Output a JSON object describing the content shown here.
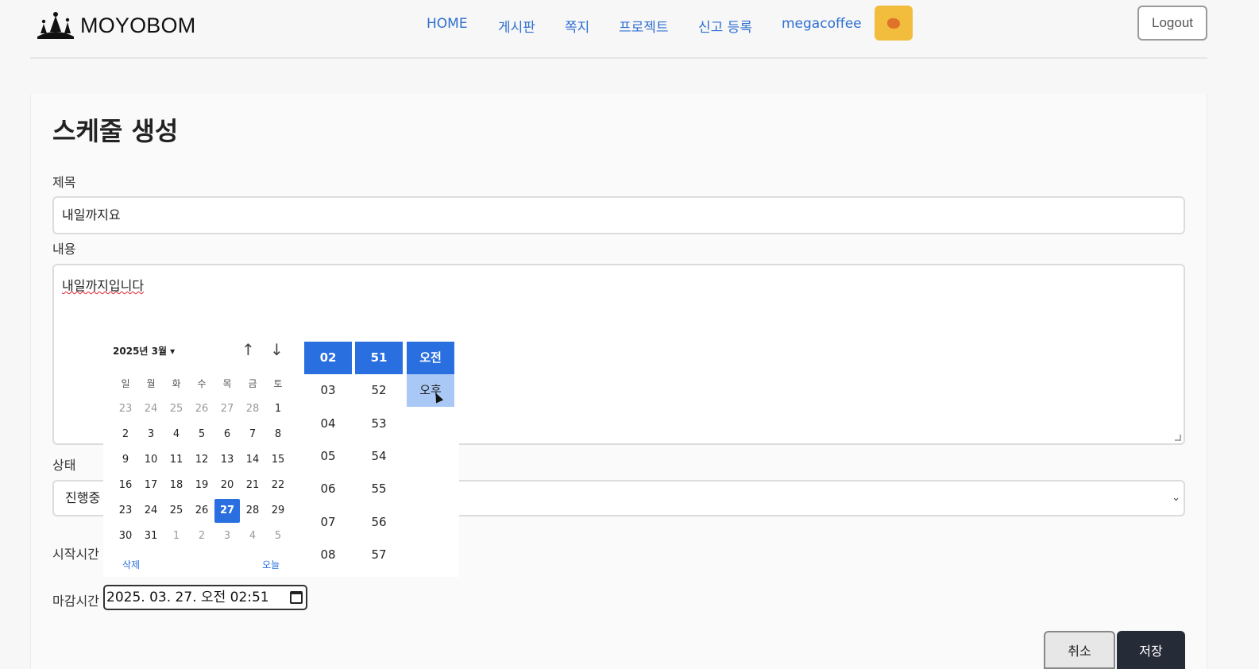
{
  "header": {
    "logo_text": "MOYOBOM",
    "nav": [
      "HOME",
      "게시판",
      "쪽지",
      "프로젝트",
      "신고 등록",
      "megacoffee"
    ],
    "logout_label": "Logout"
  },
  "form": {
    "page_title": "스케줄 생성",
    "title_label": "제목",
    "title_value": "내일까지요",
    "content_label": "내용",
    "content_value": "내일까지입니다",
    "status_label": "상태",
    "status_value": "진행중",
    "start_label": "시작시간",
    "due_label": "마감시간",
    "due_value": "2025. 03. 27. 오전 02:51"
  },
  "datepicker": {
    "month_label": "2025년 3월 ▾",
    "up_arrow": "↑",
    "down_arrow": "↓",
    "weekdays": [
      "일",
      "월",
      "화",
      "수",
      "목",
      "금",
      "토"
    ],
    "weeks": [
      [
        "23",
        "24",
        "25",
        "26",
        "27",
        "28",
        "1"
      ],
      [
        "2",
        "3",
        "4",
        "5",
        "6",
        "7",
        "8"
      ],
      [
        "9",
        "10",
        "11",
        "12",
        "13",
        "14",
        "15"
      ],
      [
        "16",
        "17",
        "18",
        "19",
        "20",
        "21",
        "22"
      ],
      [
        "23",
        "24",
        "25",
        "26",
        "27",
        "28",
        "29"
      ],
      [
        "30",
        "31",
        "1",
        "2",
        "3",
        "4",
        "5"
      ]
    ],
    "selected_day": "27",
    "clear_label": "삭제",
    "today_label": "오늘",
    "hours": [
      "02",
      "03",
      "04",
      "05",
      "06",
      "07",
      "08"
    ],
    "minutes": [
      "51",
      "52",
      "53",
      "54",
      "55",
      "56",
      "57"
    ],
    "ampm": [
      "오전",
      "오후"
    ],
    "accent_color": "#2a6fe0"
  },
  "actions": {
    "cancel_label": "취소",
    "save_label": "저장"
  }
}
